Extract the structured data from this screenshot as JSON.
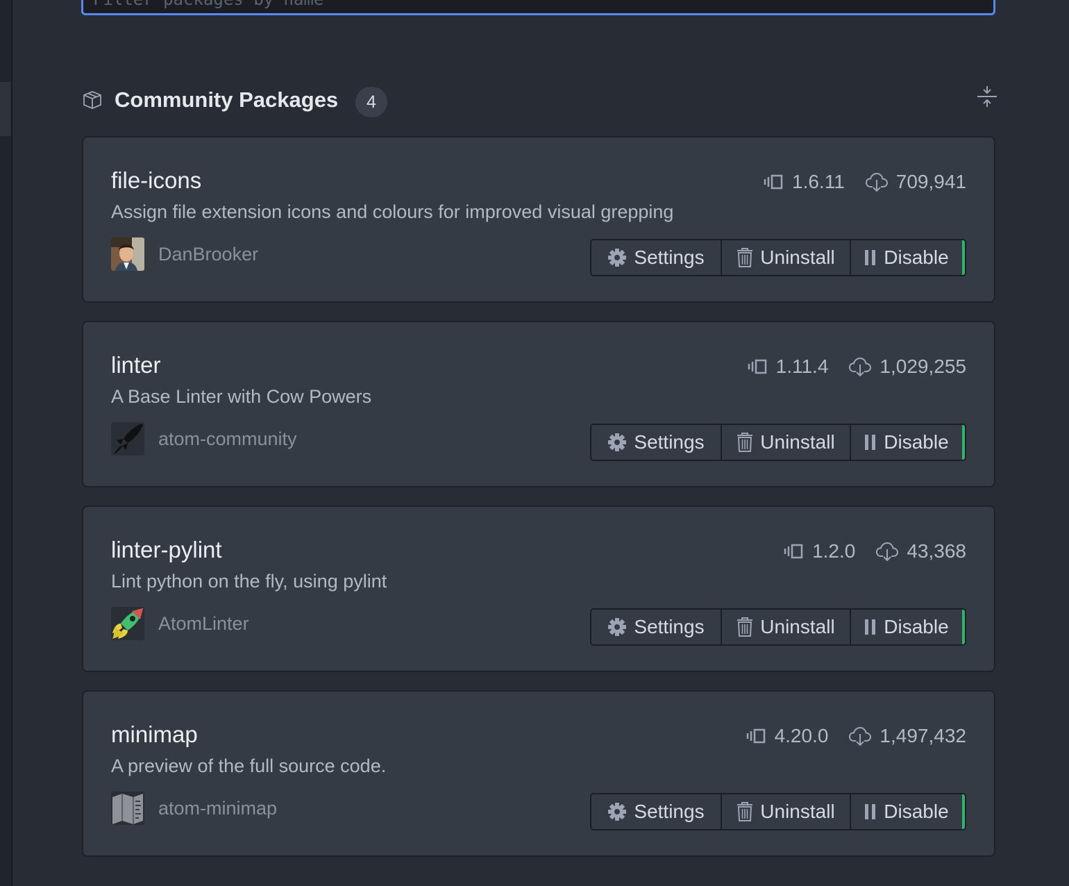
{
  "filter": {
    "placeholder": "Filter packages by name"
  },
  "section": {
    "title": "Community Packages",
    "count": "4",
    "icon": "package-icon",
    "collapse_icon": "fold-icon"
  },
  "accent": {
    "focus": "#568af2",
    "enabled": "#28b76b"
  },
  "packages": [
    {
      "name": "file-icons",
      "description": "Assign file extension icons and colours for improved visual grepping",
      "author": "DanBrooker",
      "version": "1.6.11",
      "downloads": "709,941",
      "settings_label": "Settings",
      "uninstall_label": "Uninstall",
      "disable_label": "Disable"
    },
    {
      "name": "linter",
      "description": "A Base Linter with Cow Powers",
      "author": "atom-community",
      "version": "1.11.4",
      "downloads": "1,029,255",
      "settings_label": "Settings",
      "uninstall_label": "Uninstall",
      "disable_label": "Disable"
    },
    {
      "name": "linter-pylint",
      "description": "Lint python on the fly, using pylint",
      "author": "AtomLinter",
      "version": "1.2.0",
      "downloads": "43,368",
      "settings_label": "Settings",
      "uninstall_label": "Uninstall",
      "disable_label": "Disable"
    },
    {
      "name": "minimap",
      "description": "A preview of the full source code.",
      "author": "atom-minimap",
      "version": "4.20.0",
      "downloads": "1,497,432",
      "settings_label": "Settings",
      "uninstall_label": "Uninstall",
      "disable_label": "Disable"
    }
  ]
}
